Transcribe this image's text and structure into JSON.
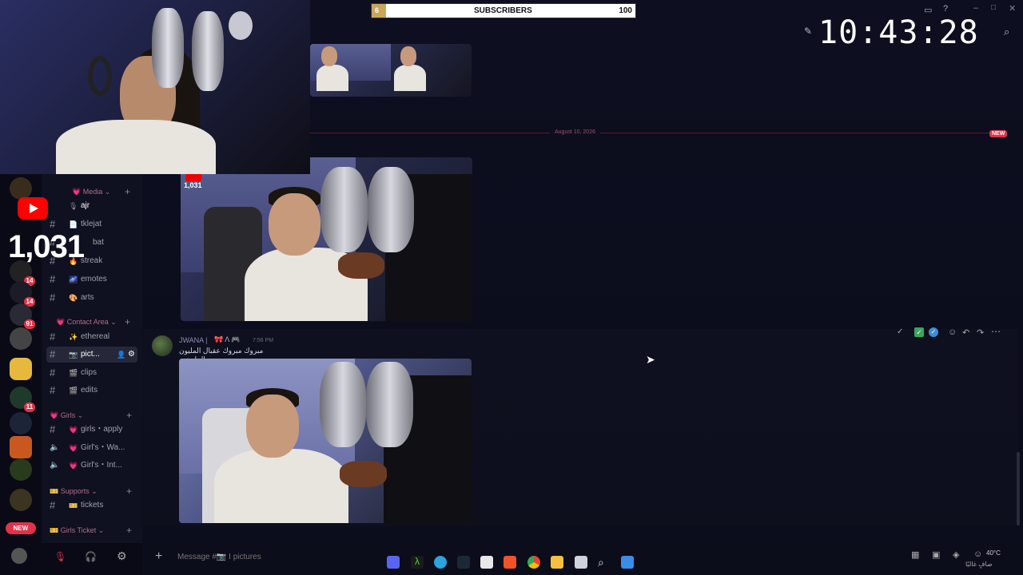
{
  "overlay": {
    "subscriber_bar": {
      "start": "6",
      "label": "SUBSCRIBERS",
      "goal": "100"
    },
    "clock": "10:43:28",
    "yt_count": "1,031",
    "photo_count": "1,031"
  },
  "sidebar": {
    "categories": [
      {
        "label": "Media"
      },
      {
        "label": "Contact Area"
      },
      {
        "label": "Girls"
      },
      {
        "label": "Supports"
      },
      {
        "label": "Girls Ticket"
      }
    ],
    "channels": [
      {
        "emoji": "🎙",
        "label": "ajr"
      },
      {
        "emoji": "📄",
        "label": "tklejat"
      },
      {
        "emoji": "",
        "label": "bat"
      },
      {
        "emoji": "🔥",
        "label": "streak"
      },
      {
        "emoji": "🌌",
        "label": "emotes"
      },
      {
        "emoji": "🎨",
        "label": "arts"
      },
      {
        "emoji": "✨",
        "label": "ethereal"
      },
      {
        "emoji": "📷",
        "label": "pict..."
      },
      {
        "emoji": "🎬",
        "label": "clips"
      },
      {
        "emoji": "🎬",
        "label": "edits"
      },
      {
        "emoji": "💗",
        "label": "girls・apply"
      },
      {
        "emoji": "💗",
        "label": "Girl's・Wa..."
      },
      {
        "emoji": "💗",
        "label": "Girl's・Int..."
      },
      {
        "emoji": "🎫",
        "label": "tickets"
      }
    ],
    "separator": "I"
  },
  "servers": {
    "badges": [
      "14",
      "14",
      "91",
      "11"
    ],
    "new_label": "NEW"
  },
  "chat": {
    "date_divider": "August 10, 2026",
    "new_badge": "NEW",
    "message": {
      "author": "JWANA |",
      "time": "7:56 PM",
      "text": "مبروك مبروك عقبال المليون والمليونين"
    },
    "composer_placeholder": "Message #📷 I pictures"
  },
  "system": {
    "weather": "40°C",
    "weather_desc": "صافٍ غالبًا"
  }
}
